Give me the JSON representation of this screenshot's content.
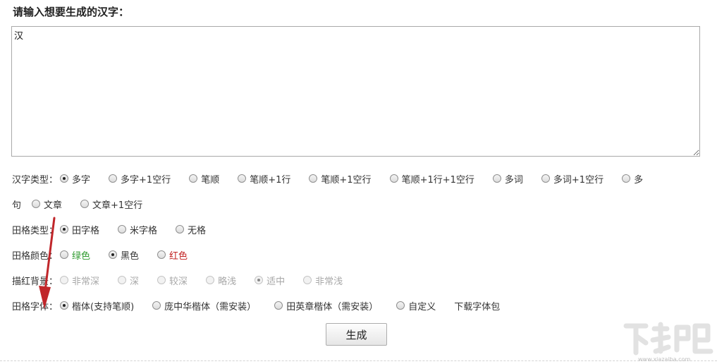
{
  "page_title": "请输入想要生成的汉字：",
  "input": {
    "value": "汉"
  },
  "char_type": {
    "label": "汉字类型：",
    "options": [
      "多字",
      "多字+1空行",
      "笔顺",
      "笔顺+1行",
      "笔顺+1空行",
      "笔顺+1行+1空行",
      "多词",
      "多词+1空行",
      "多",
      "句",
      "文章",
      "文章+1空行"
    ],
    "selected": "多字"
  },
  "grid_type": {
    "label": "田格类型：",
    "options": [
      "田字格",
      "米字格",
      "无格"
    ],
    "selected": "田字格"
  },
  "grid_color": {
    "label": "田格颜色：",
    "options": [
      "绿色",
      "黑色",
      "红色"
    ],
    "selected": "黑色"
  },
  "trace_bg": {
    "label": "描红背景：",
    "options": [
      "非常深",
      "深",
      "较深",
      "略浅",
      "适中",
      "非常浅"
    ],
    "selected": "适中"
  },
  "font": {
    "label": "田格字体：",
    "options": [
      "楷体(支持笔顺)",
      "庞中华楷体（需安装）",
      "田英章楷体（需安装）",
      "自定义"
    ],
    "selected": "楷体(支持笔顺)",
    "download_label": "下载字体包"
  },
  "submit_label": "生成",
  "watermark_text": "www.xiazaiba.com",
  "colors": {
    "green": "#2e9a2e",
    "red": "#c22222",
    "arrow": "#c0262a"
  }
}
